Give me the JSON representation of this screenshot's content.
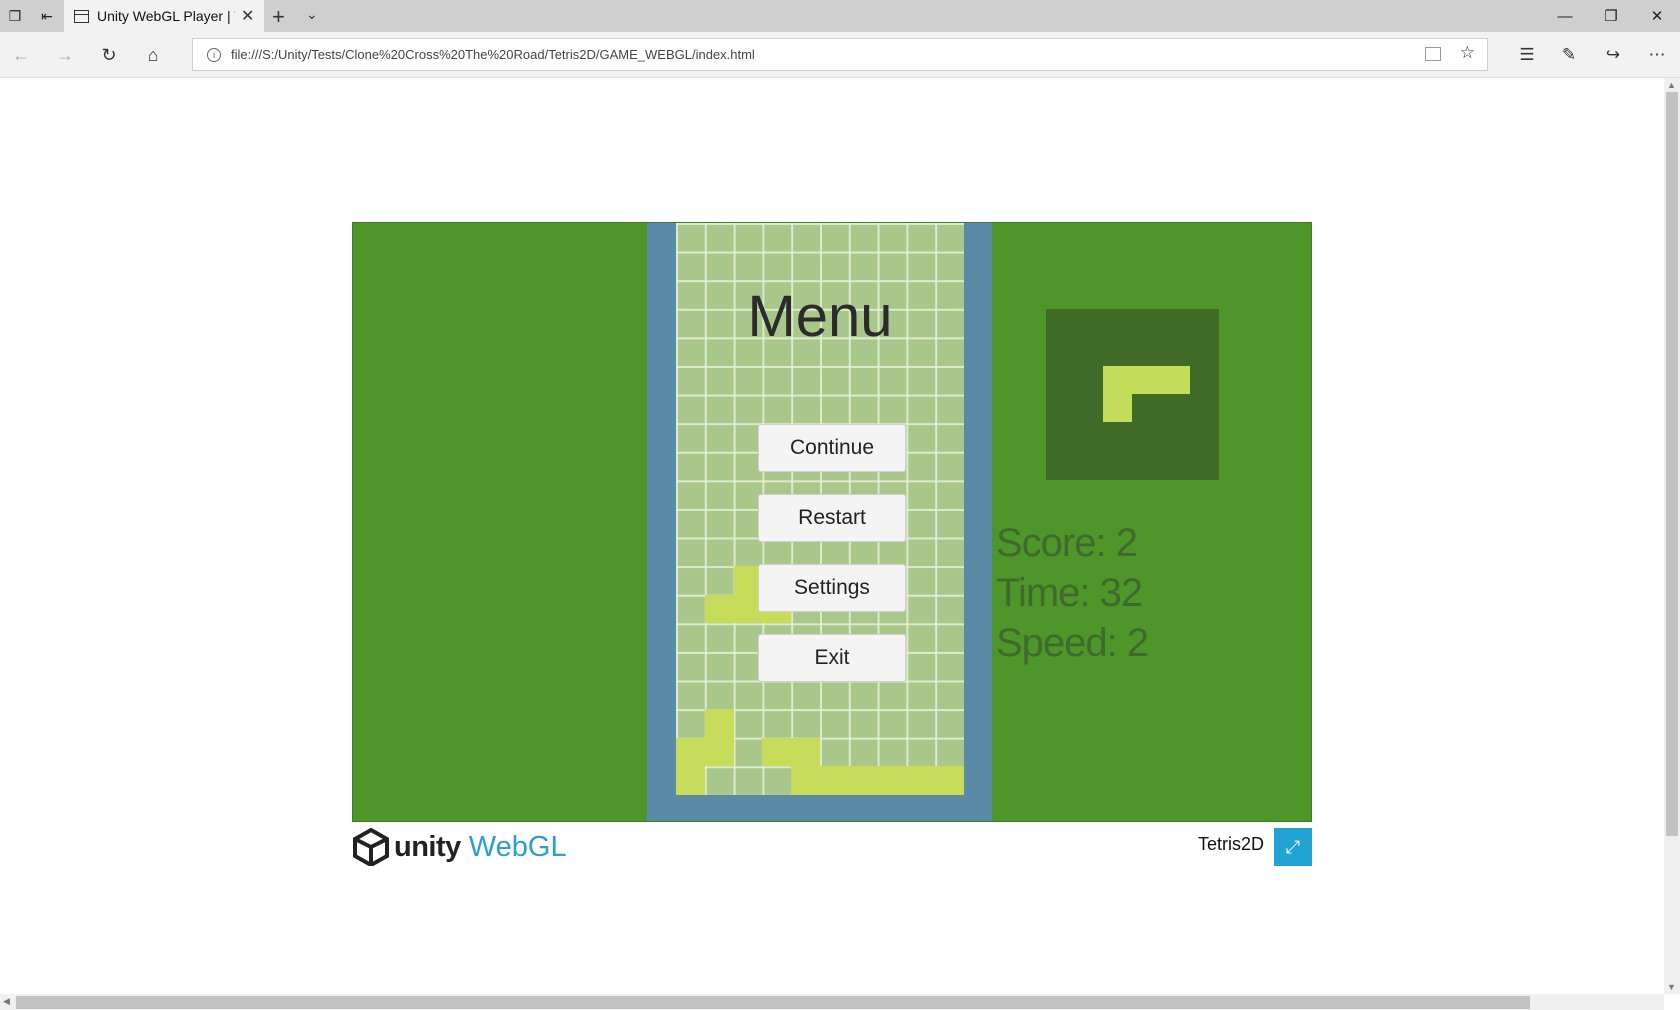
{
  "browser": {
    "tab_title": "Unity WebGL Player | Te",
    "url": "file:///S:/Unity/Tests/Clone%20Cross%20The%20Road/Tetris2D/GAME_WEBGL/index.html"
  },
  "game": {
    "menu_title": "Menu",
    "buttons": {
      "continue": "Continue",
      "restart": "Restart",
      "settings": "Settings",
      "exit": "Exit"
    },
    "stats": {
      "score": "Score: 2",
      "time": "Time: 32",
      "speed": "Speed: 2"
    }
  },
  "footer": {
    "logo_word": "unity",
    "logo_suffix": "WebGL",
    "game_name": "Tetris2D"
  },
  "colors": {
    "background_green": "#4e962a",
    "well_blue": "#5a8aa6",
    "grid_light": "#a9c78b",
    "block_yellow": "#c8dc5c",
    "preview_dark": "#3f6a28",
    "accent_blue": "#21a3d6"
  }
}
